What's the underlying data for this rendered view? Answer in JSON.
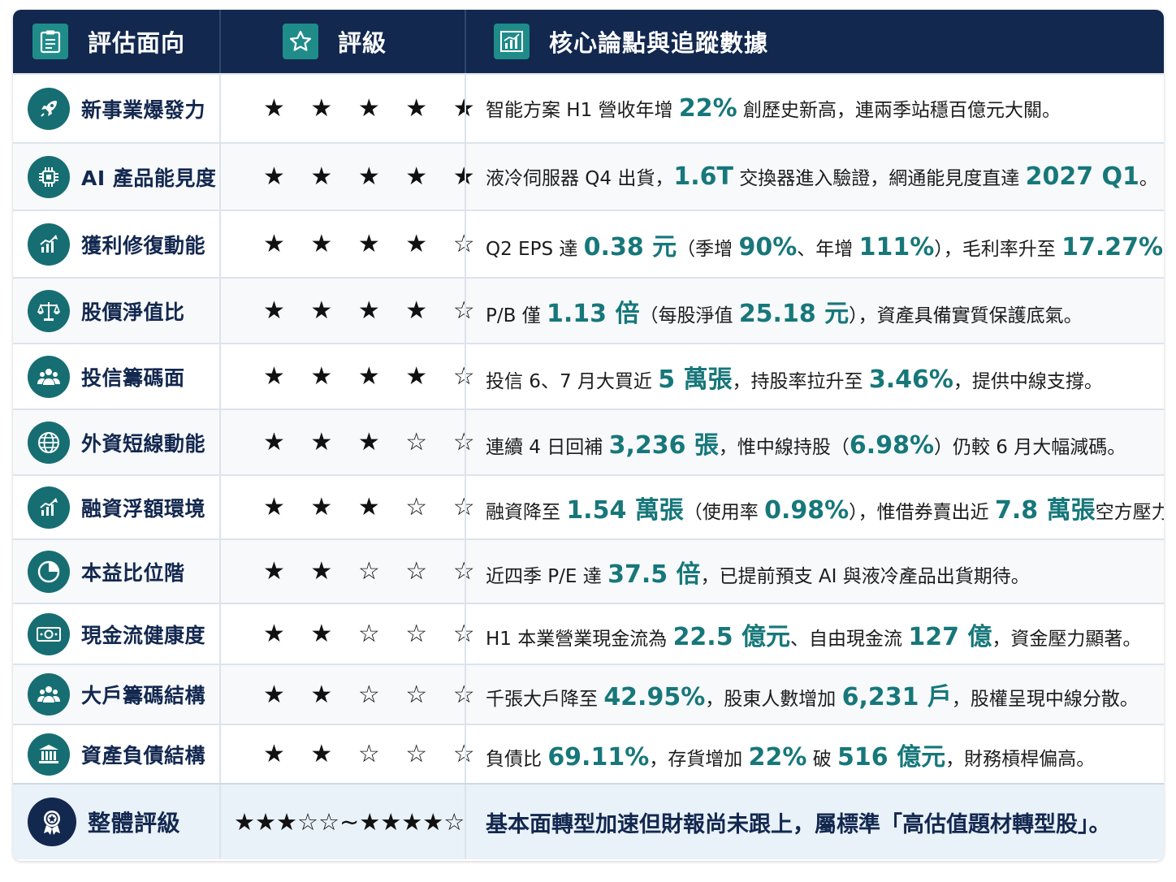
{
  "header": {
    "col1": "評估面向",
    "col2": "評級",
    "col3": "核心論點與追蹤數據"
  },
  "rows": [
    {
      "label": "新事業爆發力",
      "icon": "rocket-icon",
      "stars": "★ ★ ★ ★ ★",
      "segs": [
        "智能方案 H1 營收年增 ",
        "22%",
        " 創歷史新高，連兩季站穩百億元大關。"
      ]
    },
    {
      "label": "AI 產品能見度",
      "icon": "chip-icon",
      "stars": "★ ★ ★ ★ ★",
      "segs": [
        "液冷伺服器 Q4 出貨，",
        "1.6T",
        " 交換器進入驗證，網通能見度直達 ",
        "2027 Q1",
        "。"
      ]
    },
    {
      "label": "獲利修復動能",
      "icon": "growth-chart-icon",
      "stars": "★ ★ ★ ★ ☆",
      "segs": [
        "Q2 EPS 達 ",
        "0.38 元",
        "（季增 ",
        "90%",
        "、年增 ",
        "111%",
        "），毛利率升至 ",
        "17.27%",
        "。"
      ]
    },
    {
      "label": "股價淨值比",
      "icon": "balance-scale-icon",
      "stars": "★ ★ ★ ★ ☆",
      "segs": [
        "P/B 僅 ",
        "1.13 倍",
        "（每股淨值 ",
        "25.18 元",
        "），資產具備實質保護底氣。"
      ]
    },
    {
      "label": "投信籌碼面",
      "icon": "people-group-icon",
      "stars": "★ ★ ★ ★ ☆",
      "segs": [
        "投信 6、7 月大買近 ",
        "5 萬張",
        "，持股率拉升至 ",
        "3.46%",
        "，提供中線支撐。"
      ]
    },
    {
      "label": "外資短線動能",
      "icon": "globe-icon",
      "stars": "★ ★ ★ ☆ ☆",
      "segs": [
        "連續 4 日回補 ",
        "3,236 張",
        "，惟中線持股（",
        "6.98%",
        "）仍較 6 月大幅減碼。"
      ]
    },
    {
      "label": "融資浮額環境",
      "icon": "growth-chart-icon",
      "stars": "★ ★ ★ ☆ ☆",
      "segs": [
        "融資降至 ",
        "1.54 萬張",
        "（使用率 ",
        "0.98%",
        "），惟借券賣出近 ",
        "7.8 萬張",
        "空方壓力在。"
      ]
    },
    {
      "label": "本益比位階",
      "icon": "pie-chart-icon",
      "stars": "★ ★ ☆ ☆ ☆",
      "segs": [
        "近四季 P/E 達 ",
        "37.5 倍",
        "，已提前預支 AI 與液冷產品出貨期待。"
      ]
    },
    {
      "label": "現金流健康度",
      "icon": "banknote-icon",
      "stars": "★ ★ ☆ ☆ ☆",
      "segs": [
        "H1 本業營業現金流為 ",
        "22.5 億元",
        "、自由現金流 ",
        "127 億",
        "，資金壓力顯著。"
      ]
    },
    {
      "label": "大戶籌碼結構",
      "icon": "people-group-icon",
      "stars": "★ ★ ☆ ☆ ☆",
      "segs": [
        "千張大戶降至 ",
        "42.95%",
        "，股東人數增加 ",
        "6,231 戶",
        "，股權呈現中線分散。"
      ]
    },
    {
      "label": "資產負債結構",
      "icon": "bank-icon",
      "stars": "★ ★ ☆ ☆ ☆",
      "segs": [
        "負債比 ",
        "69.11%",
        "，存貨增加 ",
        "22%",
        " 破 ",
        "516 億元",
        "，財務槓桿偏高。"
      ]
    }
  ],
  "total": {
    "label": "整體評級",
    "icon": "award-badge-icon",
    "stars": "★★★☆☆~★★★★☆",
    "text": "基本面轉型加速但財報尚未跟上，屬標準「高估值題材轉型股」。"
  },
  "colors": {
    "header_bg": "#13284f",
    "accent": "#17777a",
    "icon_bg": "#176e72"
  }
}
